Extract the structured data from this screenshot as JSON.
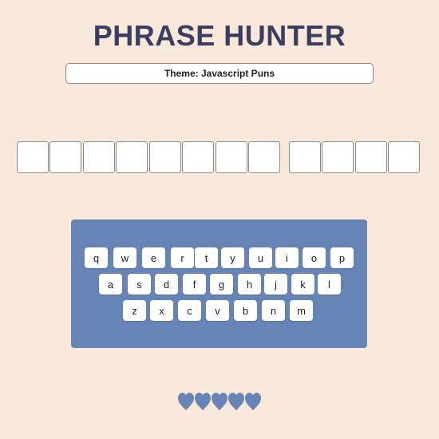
{
  "game": {
    "title": "PHRASE HUNTER",
    "theme_label": "Theme: Javascript Puns"
  },
  "phrase": {
    "words": [
      {
        "letters": [
          "",
          "",
          "",
          "",
          "",
          "",
          "",
          ""
        ]
      },
      {
        "letters": [
          "",
          "",
          "",
          ""
        ]
      }
    ]
  },
  "keyboard": {
    "rows": [
      [
        "q",
        "w",
        "e",
        "r",
        "t",
        "y",
        "u",
        "i",
        "o",
        "p"
      ],
      [
        "a",
        "s",
        "d",
        "f",
        "g",
        "h",
        "j",
        "k",
        "l"
      ],
      [
        "z",
        "x",
        "c",
        "v",
        "b",
        "n",
        "m"
      ]
    ]
  },
  "lives": {
    "remaining": 5,
    "total": 5,
    "icon": "heart-icon"
  },
  "colors": {
    "background": "#f8e9da",
    "title": "#3b3d63",
    "keyboard_panel": "#6685b6",
    "heart": "#6685b6"
  }
}
